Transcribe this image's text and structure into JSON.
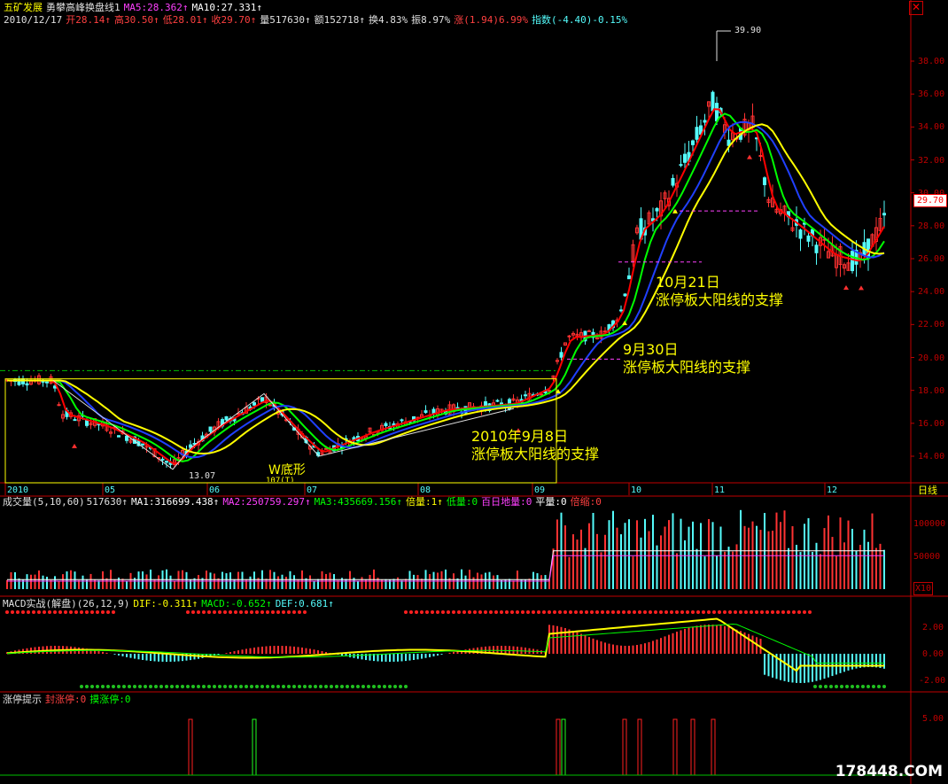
{
  "stock": {
    "name": "五矿发展",
    "indicator_name": "勇攀高峰换盘线1",
    "ma5_text": "MA5:28.362↑",
    "ma10_text": "MA10:27.331↑"
  },
  "quote": {
    "date": "2010/12/17",
    "open": "开28.14↑",
    "high": "高30.50↑",
    "low": "低28.01↑",
    "close": "收29.70↑",
    "volume": "量517630↑",
    "amount": "额152718↑",
    "turnover": "换4.83%",
    "amplitude": "振8.97%",
    "change": "涨(1.94)6.99%",
    "index": "指数(-4.40)-0.15%"
  },
  "price_axis": {
    "labels": [
      "38.00",
      "36.00",
      "34.00",
      "32.00",
      "30.00",
      "28.00",
      "26.00",
      "24.00",
      "22.00",
      "20.00",
      "18.00",
      "16.00",
      "14.00"
    ],
    "current_price": "29.70",
    "high_marker": "39.90",
    "low_marker": "13.07"
  },
  "time_axis": {
    "labels": [
      "2010",
      "05",
      "06",
      "07",
      "08",
      "09",
      "10",
      "11",
      "12"
    ],
    "period": "日线"
  },
  "annotations": {
    "w_bottom": "W底形",
    "note1_line1": "2010年9月8日",
    "note1_line2": "涨停板大阳线的支撑",
    "note2_line1": "9月30日",
    "note2_line2": "涨停板大阳线的支撑",
    "note3_line1": "10月21日",
    "note3_line2": "涨停板大阳线的支撑",
    "small_mark": "107(T)"
  },
  "volume_panel": {
    "title": "成交量(5,10,60)",
    "value": "517630↑",
    "ma1": "MA1:316699.438↑",
    "ma2": "MA2:250759.297↑",
    "ma3": "MA3:435669.156↑",
    "times": "倍量:1↑",
    "low": "低量:0",
    "hundred_low": "百日地量:0",
    "flat": "平量:0",
    "shrink": "倍缩:0",
    "axis_labels": [
      "100000",
      "50000"
    ],
    "unit": "X10"
  },
  "macd_panel": {
    "title": "MACD实战(解盘)(26,12,9)",
    "dif": "DIF:-0.311↑",
    "macd": "MACD:-0.652↑",
    "def": "DEF:0.681↑",
    "axis_labels": [
      "2.00",
      "0.00",
      "-2.00"
    ]
  },
  "limit_panel": {
    "title": "涨停提示",
    "seal": "封涨停:0",
    "touch": "摸涨停:0",
    "axis_labels": [
      "5.00"
    ]
  },
  "watermark": "178448.COM",
  "colors": {
    "up": "#ff3232",
    "down": "#54fcfc",
    "ma_yellow": "#ffff00",
    "ma_red": "#ff0000",
    "ma_green": "#00ff00",
    "ma_blue": "#2040ff",
    "axis": "#c00000"
  }
}
